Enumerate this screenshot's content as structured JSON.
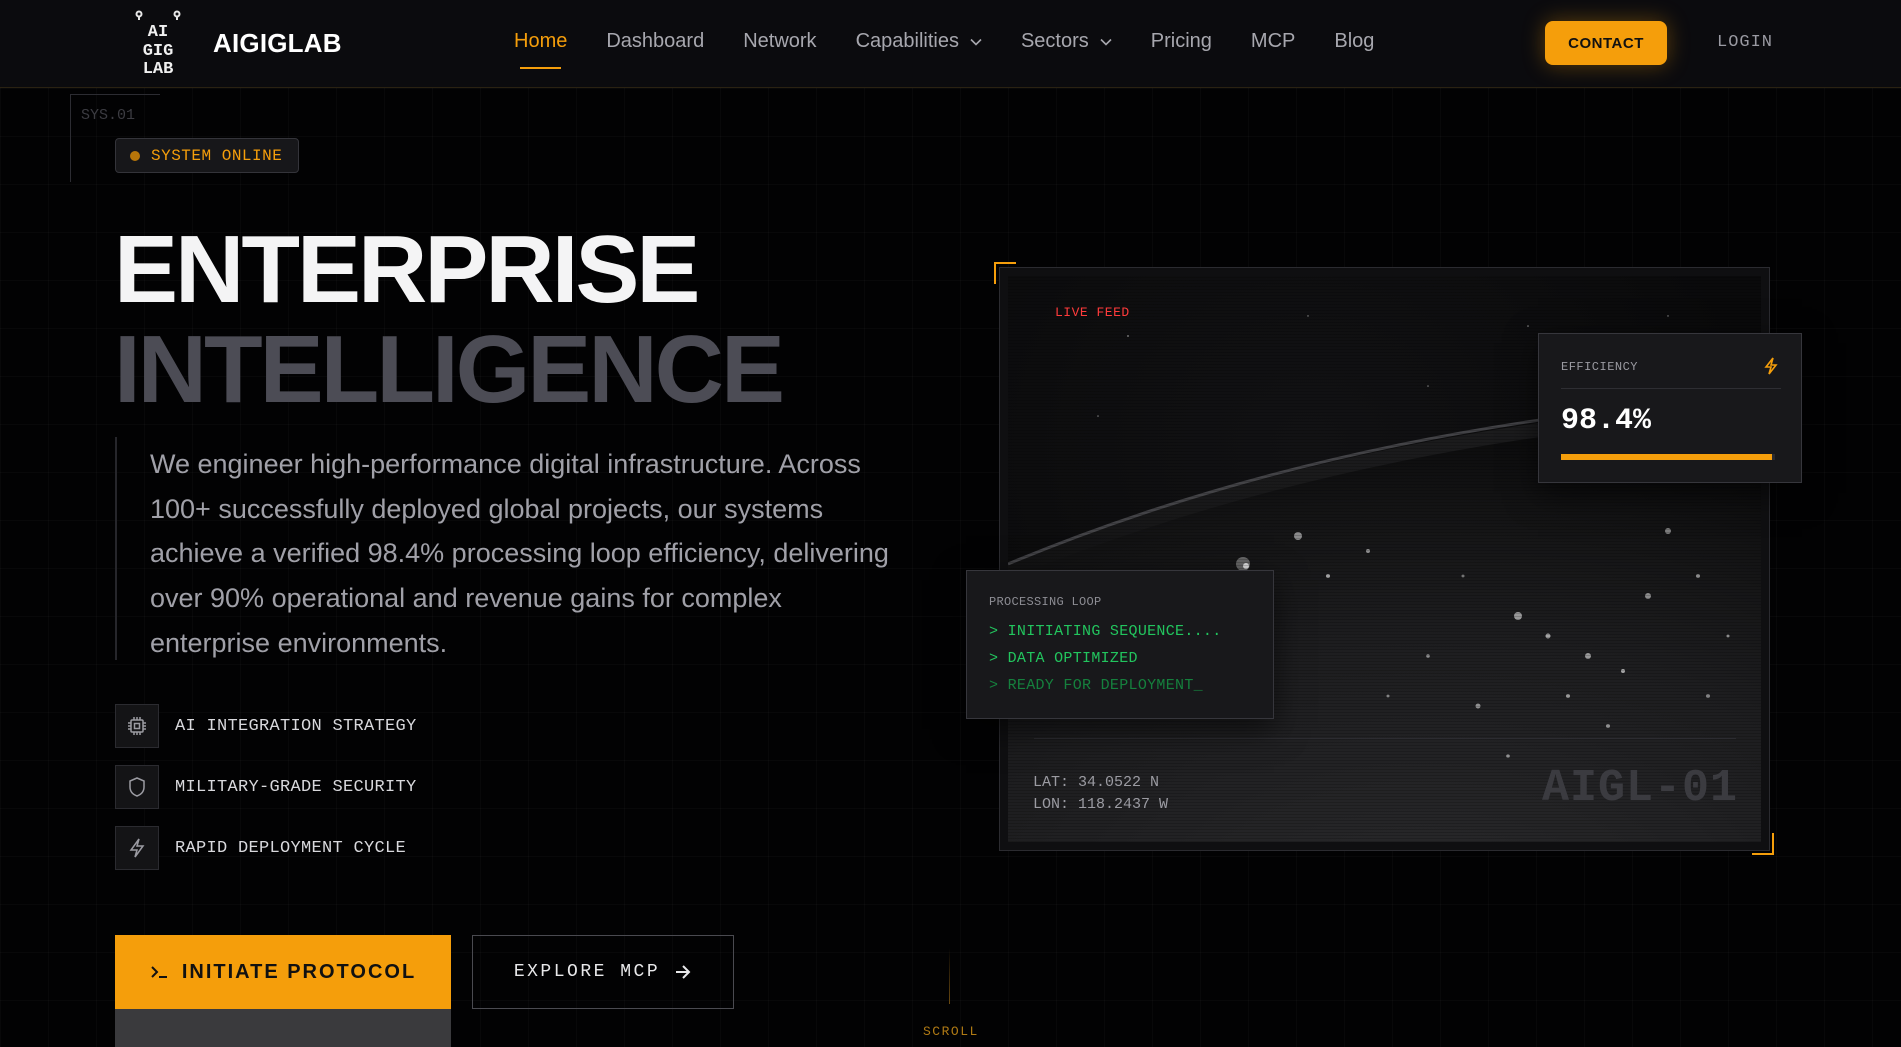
{
  "brand": {
    "name": "AIGIGLAB",
    "logo_glyphs": [
      "AI",
      "GIG",
      "LAB"
    ]
  },
  "nav": {
    "links": [
      {
        "label": "Home",
        "active": true
      },
      {
        "label": "Dashboard"
      },
      {
        "label": "Network"
      },
      {
        "label": "Capabilities",
        "dropdown": true
      },
      {
        "label": "Sectors",
        "dropdown": true
      },
      {
        "label": "Pricing"
      },
      {
        "label": "MCP"
      },
      {
        "label": "Blog"
      }
    ],
    "contact": "CONTACT",
    "login": "LOGIN"
  },
  "hero": {
    "sys_label": "SYS.01",
    "status": "SYSTEM ONLINE",
    "title_line1": "ENTERPRISE",
    "title_line2": "INTELLIGENCE",
    "description": "We engineer high-performance digital infrastructure. Across 100+ successfully deployed global projects, our systems achieve a verified 98.4% processing loop efficiency, delivering over 90% operational and revenue gains for complex enterprise environments.",
    "features": [
      {
        "icon": "chip-icon",
        "label": "AI INTEGRATION STRATEGY"
      },
      {
        "icon": "shield-icon",
        "label": "MILITARY-GRADE SECURITY"
      },
      {
        "icon": "bolt-icon",
        "label": "RAPID DEPLOYMENT CYCLE"
      }
    ],
    "cta_primary": "INITIATE PROTOCOL",
    "cta_secondary": "EXPLORE MCP",
    "scroll": "SCROLL"
  },
  "visual": {
    "live_feed": "LIVE FEED",
    "efficiency": {
      "label": "EFFICIENCY",
      "value": "98.4%",
      "progress": 0.984
    },
    "processing": {
      "title": "PROCESSING LOOP",
      "lines": [
        "> INITIATING SEQUENCE....",
        "> DATA OPTIMIZED",
        "> READY FOR DEPLOYMENT_"
      ]
    },
    "lat": "LAT: 34.0522 N",
    "lon": "LON: 118.2437 W",
    "unit_id": "AIGL-01"
  },
  "colors": {
    "accent": "#f59e0b",
    "background": "#020203",
    "live_red": "#ff3b3b",
    "terminal_green": "#22c55e",
    "terminal_green_dim": "#15803d"
  }
}
